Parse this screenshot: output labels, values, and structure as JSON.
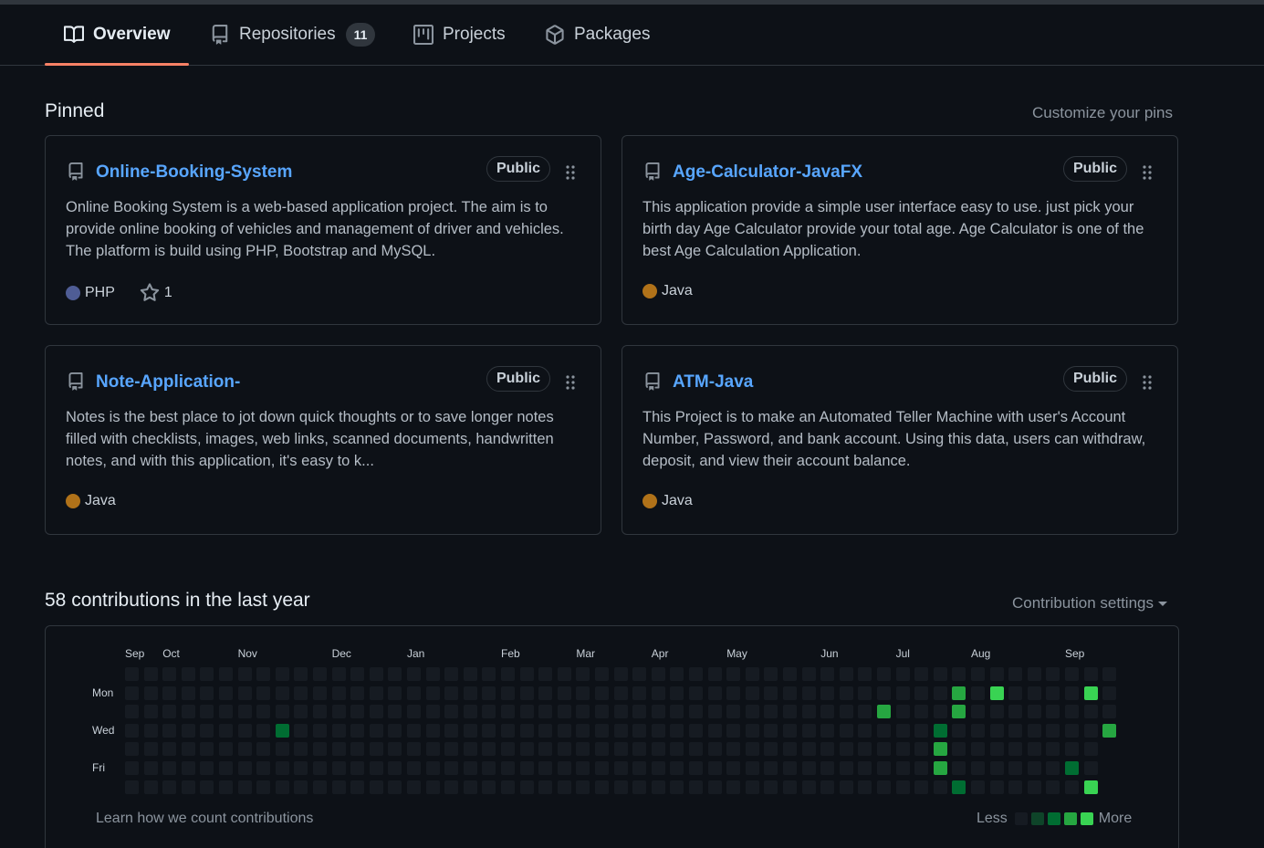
{
  "nav": {
    "tabs": [
      {
        "label": "Overview",
        "icon": "book-icon",
        "active": true
      },
      {
        "label": "Repositories",
        "icon": "repo-icon",
        "count": "11"
      },
      {
        "label": "Projects",
        "icon": "project-icon"
      },
      {
        "label": "Packages",
        "icon": "package-icon"
      }
    ]
  },
  "pinned": {
    "title": "Pinned",
    "customize_label": "Customize your pins",
    "cards": [
      {
        "name": "Online-Booking-System",
        "visibility": "Public",
        "description": "Online Booking System is a web-based application project. The aim is to provide online booking of vehicles and management of driver and vehicles. The platform is build using PHP, Bootstrap and MySQL.",
        "language": "PHP",
        "language_color": "#4F5D95",
        "stars": "1"
      },
      {
        "name": "Age-Calculator-JavaFX",
        "visibility": "Public",
        "description": "This application provide a simple user interface easy to use. just pick your birth day Age Calculator provide your total age. Age Calculator is one of the best Age Calculation Application.",
        "language": "Java",
        "language_color": "#b07219"
      },
      {
        "name": "Note-Application-",
        "visibility": "Public",
        "description": "Notes is the best place to jot down quick thoughts or to save longer notes filled with checklists, images, web links, scanned documents, handwritten notes, and with this application, it's easy to k...",
        "language": "Java",
        "language_color": "#b07219"
      },
      {
        "name": "ATM-Java",
        "visibility": "Public",
        "description": "This Project is to make an Automated Teller Machine with user's Account Number, Password, and bank account. Using this data, users can withdraw, deposit, and view their account balance.",
        "language": "Java",
        "language_color": "#b07219"
      }
    ]
  },
  "contributions": {
    "title": "58 contributions in the last year",
    "settings_label": "Contribution settings",
    "months": [
      {
        "label": "Sep",
        "week": 0
      },
      {
        "label": "Oct",
        "week": 2
      },
      {
        "label": "Nov",
        "week": 6
      },
      {
        "label": "Dec",
        "week": 11
      },
      {
        "label": "Jan",
        "week": 15
      },
      {
        "label": "Feb",
        "week": 20
      },
      {
        "label": "Mar",
        "week": 24
      },
      {
        "label": "Apr",
        "week": 28
      },
      {
        "label": "May",
        "week": 32
      },
      {
        "label": "Jun",
        "week": 37
      },
      {
        "label": "Jul",
        "week": 41
      },
      {
        "label": "Aug",
        "week": 45
      },
      {
        "label": "Sep",
        "week": 50
      }
    ],
    "days": [
      {
        "label": "Mon",
        "row": 1
      },
      {
        "label": "Wed",
        "row": 3
      },
      {
        "label": "Fri",
        "row": 5
      }
    ],
    "weeks": 53,
    "last_week_days": 4,
    "levels": [
      "#161b22",
      "#0e4429",
      "#006d32",
      "#26a641",
      "#39d353"
    ],
    "active_cells": [
      {
        "week": 8,
        "day": 3,
        "level": 2
      },
      {
        "week": 40,
        "day": 2,
        "level": 3
      },
      {
        "week": 43,
        "day": 3,
        "level": 2
      },
      {
        "week": 43,
        "day": 4,
        "level": 3
      },
      {
        "week": 43,
        "day": 5,
        "level": 3
      },
      {
        "week": 44,
        "day": 1,
        "level": 3
      },
      {
        "week": 44,
        "day": 2,
        "level": 3
      },
      {
        "week": 44,
        "day": 6,
        "level": 2
      },
      {
        "week": 46,
        "day": 1,
        "level": 4
      },
      {
        "week": 50,
        "day": 5,
        "level": 2
      },
      {
        "week": 51,
        "day": 1,
        "level": 4
      },
      {
        "week": 51,
        "day": 6,
        "level": 4
      },
      {
        "week": 52,
        "day": 3,
        "level": 3
      }
    ],
    "learn_label": "Learn how we count contributions",
    "legend_less": "Less",
    "legend_more": "More"
  }
}
